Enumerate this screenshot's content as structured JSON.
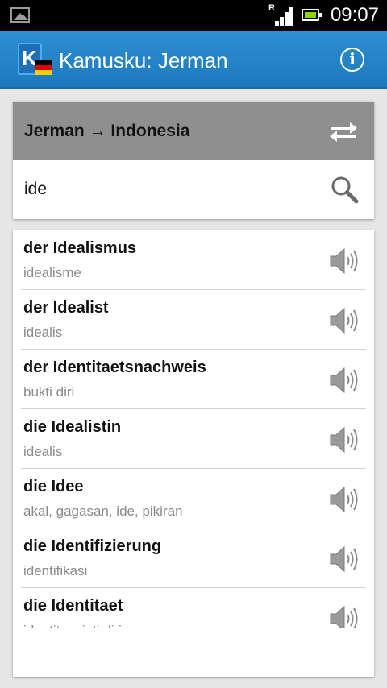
{
  "status_bar": {
    "signal_roaming": "R",
    "time": "09:07"
  },
  "action_bar": {
    "title": "Kamusku: Jerman",
    "info_label": "i",
    "logo_letter": "K"
  },
  "search": {
    "direction_label": "Jerman → Indonesia",
    "query": "ide",
    "swap_icon": "swap-arrows-icon",
    "search_icon": "magnifier-icon"
  },
  "results": [
    {
      "word": "der Idealismus",
      "meaning": "idealisme"
    },
    {
      "word": "der Idealist",
      "meaning": "idealis"
    },
    {
      "word": "der Identitaetsnachweis",
      "meaning": "bukti diri"
    },
    {
      "word": "die Idealistin",
      "meaning": "idealis"
    },
    {
      "word": "die Idee",
      "meaning": "akal, gagasan, ide, pikiran"
    },
    {
      "word": "die Identifizierung",
      "meaning": "identifikasi"
    },
    {
      "word": "die Identitaet",
      "meaning": "identitas, jati diri"
    }
  ],
  "colors": {
    "action_bar": "#1d79be",
    "lang_header": "#8f8f8f",
    "background": "#e6e6e6"
  }
}
